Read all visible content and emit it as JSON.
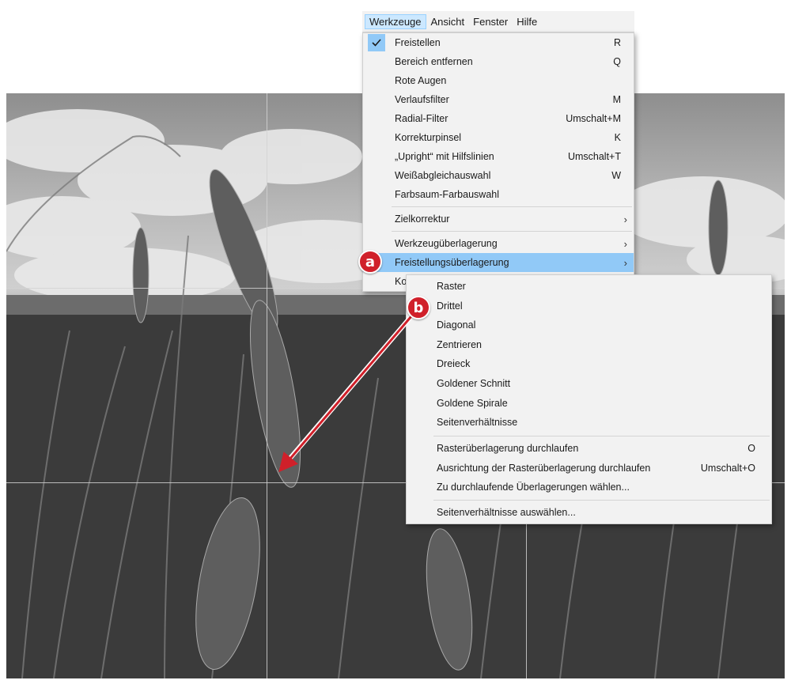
{
  "menubar": {
    "items": [
      "Werkzeuge",
      "Ansicht",
      "Fenster",
      "Hilfe"
    ],
    "active": "Werkzeuge"
  },
  "tools_menu": {
    "items": [
      {
        "label": "Freistellen",
        "shortcut": "R",
        "checked": true
      },
      {
        "label": "Bereich entfernen",
        "shortcut": "Q"
      },
      {
        "label": "Rote Augen",
        "shortcut": ""
      },
      {
        "label": "Verlaufsfilter",
        "shortcut": "M"
      },
      {
        "label": "Radial-Filter",
        "shortcut": "Umschalt+M"
      },
      {
        "label": "Korrekturpinsel",
        "shortcut": "K"
      },
      {
        "label": "„Upright“ mit Hilfslinien",
        "shortcut": "Umschalt+T"
      },
      {
        "label": "Weißabgleichauswahl",
        "shortcut": "W"
      },
      {
        "label": "Farbsaum-Farbauswahl",
        "shortcut": ""
      },
      {
        "label": "Zielkorrektur",
        "submenu": true
      },
      {
        "label": "Werkzeugüberlagerung",
        "submenu": true
      },
      {
        "label": "Freistellungsüberlagerung",
        "submenu": true,
        "highlighted": true
      },
      {
        "label": "Ko",
        "shortcut": ""
      }
    ]
  },
  "overlay_submenu": {
    "items": [
      {
        "label": "Raster"
      },
      {
        "label": "Drittel"
      },
      {
        "label": "Diagonal"
      },
      {
        "label": "Zentrieren"
      },
      {
        "label": "Dreieck"
      },
      {
        "label": "Goldener Schnitt"
      },
      {
        "label": "Goldene Spirale"
      },
      {
        "label": "Seitenverhältnisse"
      },
      {
        "label": "Rasterüberlagerung durchlaufen",
        "shortcut": "O"
      },
      {
        "label": "Ausrichtung der Rasterüberlagerung durchlaufen",
        "shortcut": "Umschalt+O"
      },
      {
        "label": "Zu durchlaufende Überlagerungen wählen..."
      },
      {
        "label": "Seitenverhältnisse auswählen..."
      }
    ]
  },
  "callouts": {
    "a": "a",
    "b": "b"
  },
  "colors": {
    "highlight": "#91c9f7",
    "menu_bg": "#f2f2f2",
    "callout": "#d0202a",
    "menubar_active": "#cce8ff"
  },
  "icons": [
    "checkmark-icon",
    "chevron-right-icon"
  ]
}
